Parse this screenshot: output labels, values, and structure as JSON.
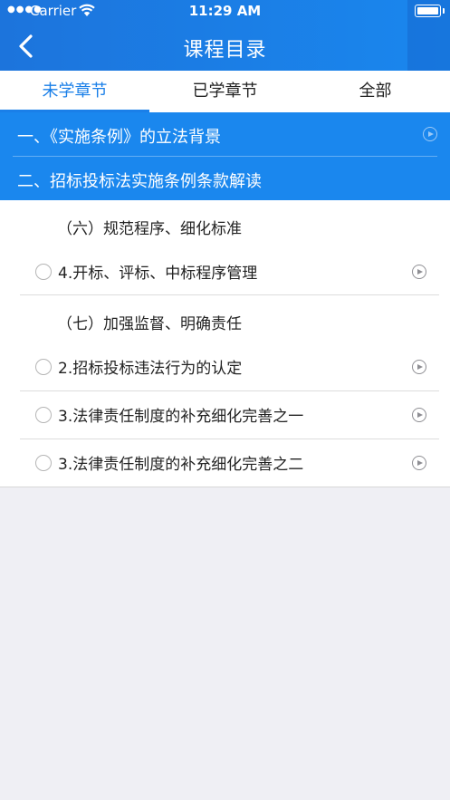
{
  "status_bar": {
    "carrier": "Carrier",
    "time": "11:29 AM"
  },
  "nav": {
    "title": "课程目录",
    "back_icon": "chevron-left-icon"
  },
  "tabs": [
    {
      "label": "未学章节",
      "active": true
    },
    {
      "label": "已学章节",
      "active": false
    },
    {
      "label": "全部",
      "active": false
    }
  ],
  "chapters": [
    {
      "label": "一、《实施条例》的立法背景",
      "icon": "play-circle-icon"
    },
    {
      "label": "二、招标投标法实施条例条款解读"
    }
  ],
  "sections": [
    {
      "title": "（六）规范程序、细化标准",
      "lessons": [
        {
          "label": "4.开标、评标、中标程序管理",
          "icon": "play-circle-icon"
        }
      ]
    },
    {
      "title": "（七）加强监督、明确责任",
      "lessons": [
        {
          "label": "2.招标投标违法行为的认定",
          "icon": "play-circle-icon"
        },
        {
          "label": "3.法律责任制度的补充细化完善之一",
          "icon": "play-circle-icon"
        },
        {
          "label": "3.法律责任制度的补充细化完善之二",
          "icon": "play-circle-icon"
        }
      ]
    }
  ],
  "colors": {
    "primary": "#1a87ee",
    "header": "#1c74dc",
    "active_tab": "#1a7fe8",
    "background": "#efeff4"
  }
}
